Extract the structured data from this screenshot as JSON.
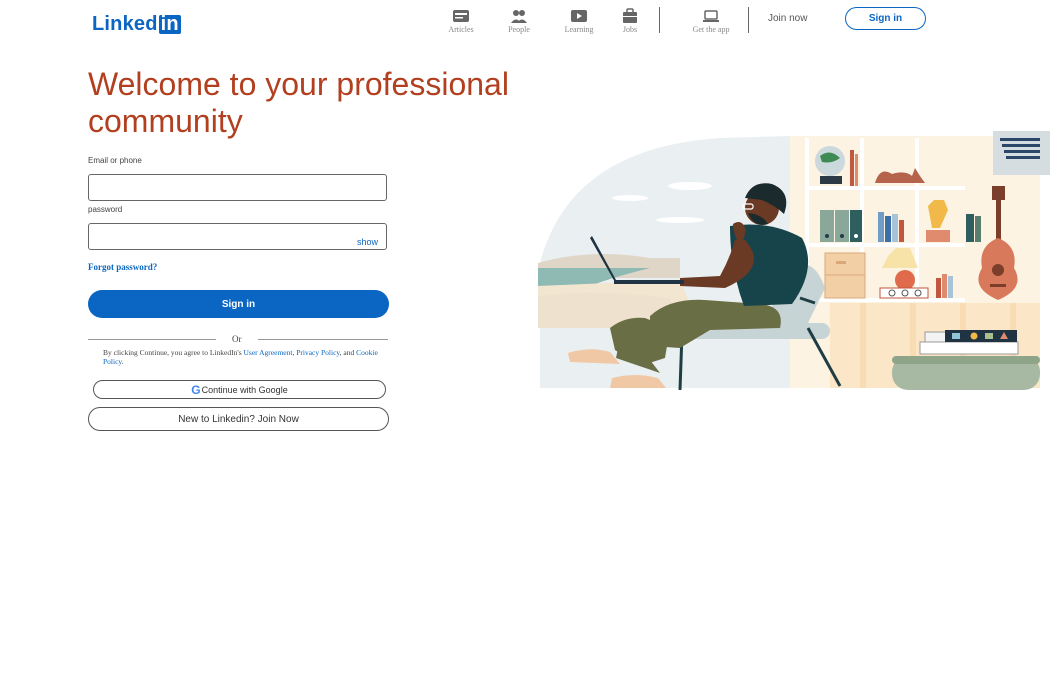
{
  "brand": {
    "logo_text": "Linked",
    "logo_in": "in",
    "accent": "#0a66c2",
    "heading_color": "#b24020"
  },
  "nav": {
    "items": [
      {
        "label": "Articles",
        "icon": "articles-icon"
      },
      {
        "label": "People",
        "icon": "people-icon"
      },
      {
        "label": "Learning",
        "icon": "learning-icon"
      },
      {
        "label": "Jobs",
        "icon": "jobs-icon"
      },
      {
        "label": "Get the app",
        "icon": "laptop-icon"
      }
    ],
    "join_now": "Join now",
    "sign_in": "Sign in"
  },
  "hero": {
    "heading": "Welcome to your professional community"
  },
  "form": {
    "email_label": "Email or phone",
    "email_value": "",
    "password_label": "password",
    "password_value": "",
    "show_label": "show",
    "forgot_password": "Forgot password?",
    "sign_in": "Sign in",
    "or": "Or",
    "terms_prefix": "By clicking Continue, you agree to LinkedIn's ",
    "terms_user_agreement": "User Agreement",
    "terms_comma": ", ",
    "terms_privacy": "Privacy Policy",
    "terms_and": ", and ",
    "terms_cookie": "Cookie Policy",
    "terms_end": ".",
    "google_g": "G",
    "google_button": "Continue with Google",
    "join_button": "New to Linkedin? Join Now"
  }
}
